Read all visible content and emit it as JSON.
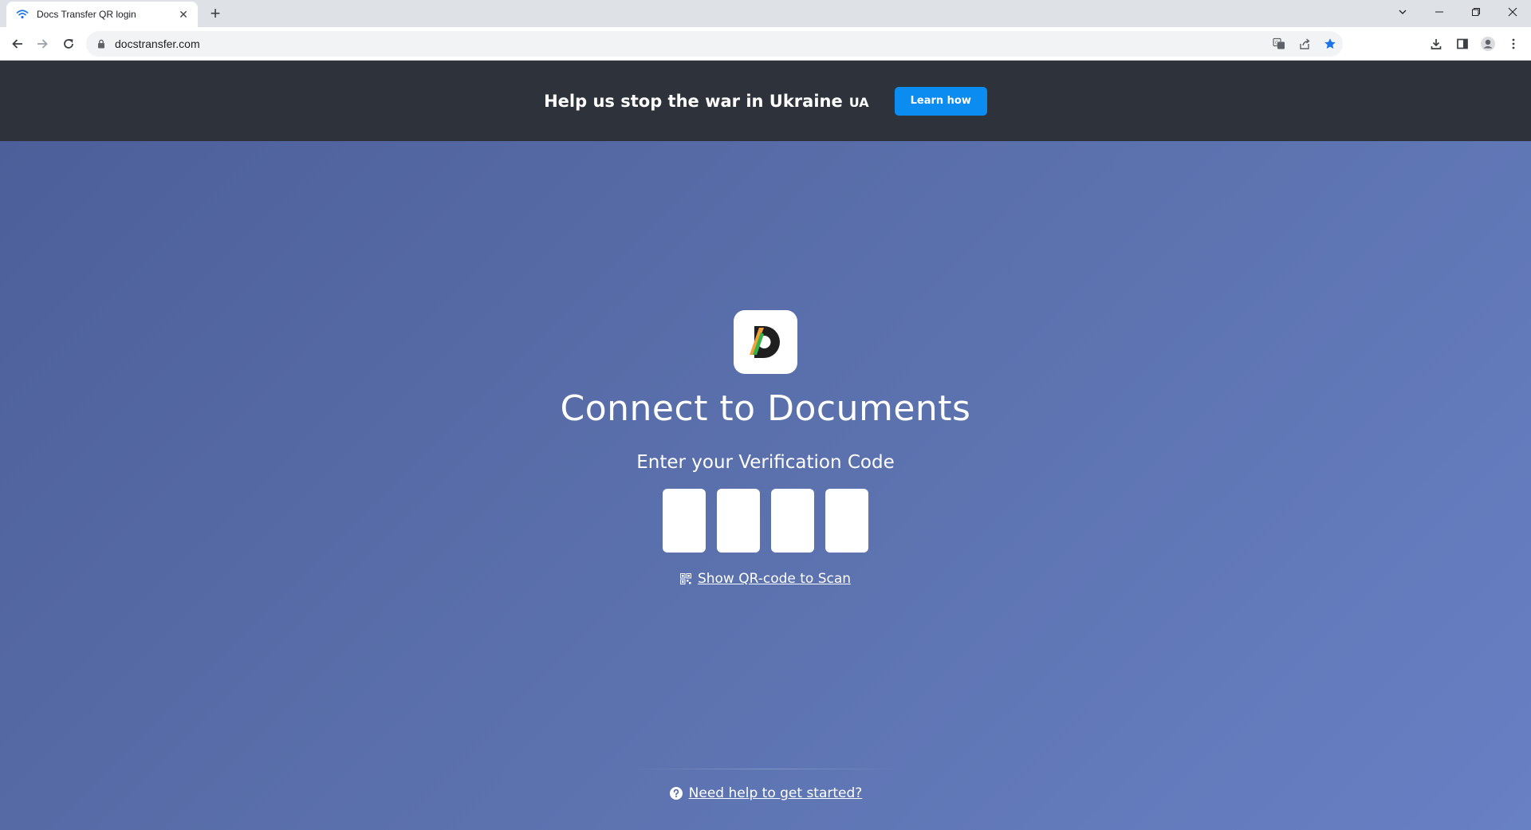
{
  "browser": {
    "tab_title": "Docs Transfer QR login",
    "url": "docstransfer.com",
    "colors": {
      "bookmark_star": "#1a73e8",
      "favicon": "#1a73e8"
    }
  },
  "banner": {
    "text": "Help us stop the war in Ukraine",
    "badge": "UA",
    "button_label": "Learn how",
    "button_color": "#0a8cf0"
  },
  "main": {
    "title": "Connect to Documents",
    "subtitle": "Enter your Verification Code",
    "code_fields": [
      "",
      "",
      "",
      ""
    ],
    "qr_link": "Show QR-code to Scan",
    "help_link": "Need help to get started?"
  },
  "icons": {
    "favicon": "wifi-icon",
    "logo": "documents-d-logo",
    "qr": "qr-code-icon",
    "help": "question-circle-icon"
  }
}
